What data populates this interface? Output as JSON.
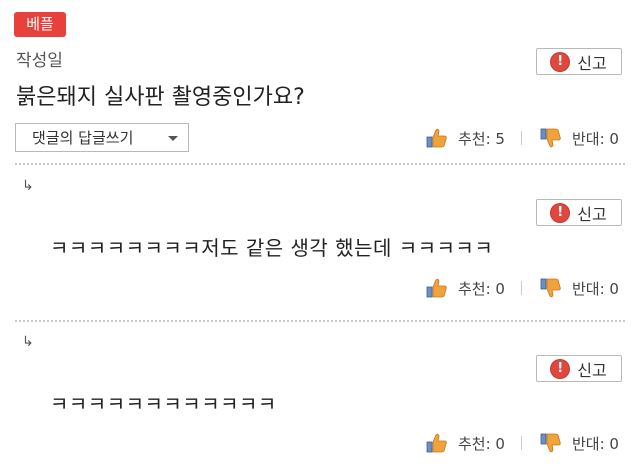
{
  "post": {
    "badge": "베플",
    "date_label": "작성일",
    "title": "붉은돼지 실사판 촬영중인가요?",
    "reply_select": "댓글의 답글쓰기",
    "report_label": "신고",
    "upvote_label": "추천: 5",
    "downvote_label": "반대: 0"
  },
  "replies": [
    {
      "reply_icon": "↳",
      "text": "ㅋㅋㅋㅋㅋㅋㅋㅋ저도 같은 생각 했는데 ㅋㅋㅋㅋㅋ",
      "report_label": "신고",
      "upvote_label": "추천: 0",
      "downvote_label": "반대: 0"
    },
    {
      "reply_icon": "↳",
      "text": "ㅋㅋㅋㅋㅋㅋㅋㅋㅋㅋㅋㅋ",
      "report_label": "신고",
      "upvote_label": "추천: 0",
      "downvote_label": "반대: 0"
    }
  ]
}
